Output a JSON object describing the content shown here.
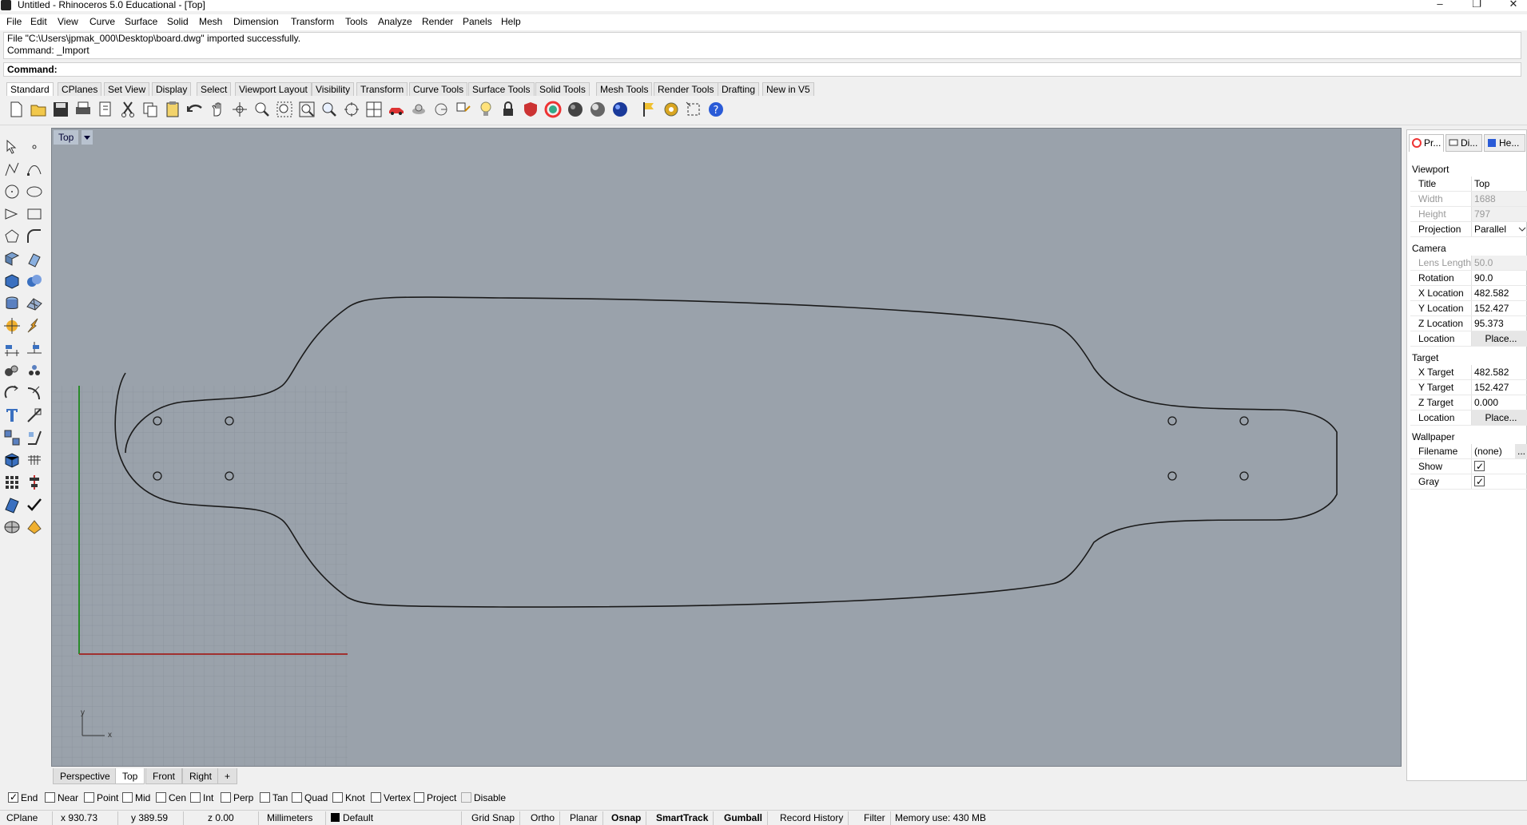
{
  "window": {
    "title": "Untitled - Rhinoceros 5.0 Educational - [Top]",
    "minimize": "–",
    "restore": "❐",
    "close": "✕"
  },
  "menu": [
    "File",
    "Edit",
    "View",
    "Curve",
    "Surface",
    "Solid",
    "Mesh",
    "Dimension",
    "Transform",
    "Tools",
    "Analyze",
    "Render",
    "Panels",
    "Help"
  ],
  "command_history": [
    "File \"C:\\Users\\jpmak_000\\Desktop\\board.dwg\" imported successfully.",
    "Command: _Import"
  ],
  "command_prompt": "Command:",
  "toolbar_tabs": [
    "Standard",
    "CPlanes",
    "Set View",
    "Display",
    "Select",
    "Viewport Layout",
    "Visibility",
    "Transform",
    "Curve Tools",
    "Surface Tools",
    "Solid Tools",
    "Mesh Tools",
    "Render Tools",
    "Drafting",
    "New in V5"
  ],
  "toolbar_icons": [
    "new-icon",
    "open-icon",
    "save-icon",
    "print-icon",
    "import-icon",
    "cut-icon",
    "copy-icon",
    "paste-icon",
    "undo-icon",
    "pan-icon",
    "rotate-view-icon",
    "zoom-window-icon",
    "zoom-extents-icon",
    "zoom-selected-icon",
    "zoom-icon",
    "zoom-all-icon",
    "four-viewports-icon",
    "car-icon",
    "gumball-icon",
    "circle-icon",
    "object-snap-icon",
    "light-icon",
    "lock-icon",
    "shield-icon",
    "color-wheel-icon",
    "shaded-sphere-icon",
    "rendered-sphere-icon",
    "blue-sphere-icon",
    "flag-icon",
    "options-gear-icon",
    "bounding-box-icon",
    "help-icon"
  ],
  "viewport": {
    "title": "Top",
    "axis_x": "x",
    "axis_y": "y"
  },
  "viewport_tabs": [
    "Perspective",
    "Top",
    "Front",
    "Right",
    "+"
  ],
  "osnap": [
    {
      "label": "End",
      "checked": true
    },
    {
      "label": "Near",
      "checked": false
    },
    {
      "label": "Point",
      "checked": false
    },
    {
      "label": "Mid",
      "checked": false
    },
    {
      "label": "Cen",
      "checked": false
    },
    {
      "label": "Int",
      "checked": false
    },
    {
      "label": "Perp",
      "checked": false
    },
    {
      "label": "Tan",
      "checked": false
    },
    {
      "label": "Quad",
      "checked": false
    },
    {
      "label": "Knot",
      "checked": false
    },
    {
      "label": "Vertex",
      "checked": false
    },
    {
      "label": "Project",
      "checked": false
    },
    {
      "label": "Disable",
      "checked": false
    }
  ],
  "status": {
    "cplane": "CPlane",
    "x": "x 930.73",
    "y": "y 389.59",
    "z": "z 0.00",
    "units": "Millimeters",
    "layer": "Default",
    "grid_snap": "Grid Snap",
    "ortho": "Ortho",
    "planar": "Planar",
    "osnap": "Osnap",
    "smarttrack": "SmartTrack",
    "gumball": "Gumball",
    "record_history": "Record History",
    "filter": "Filter",
    "memory": "Memory use: 430 MB"
  },
  "panel": {
    "tabs": [
      "Pr...",
      "Di...",
      "He..."
    ],
    "viewport_section": "Viewport",
    "title_label": "Title",
    "title_value": "Top",
    "width_label": "Width",
    "width_value": "1688",
    "height_label": "Height",
    "height_value": "797",
    "projection_label": "Projection",
    "projection_value": "Parallel",
    "camera_section": "Camera",
    "lens_label": "Lens Length",
    "lens_value": "50.0",
    "rotation_label": "Rotation",
    "rotation_value": "90.0",
    "xloc_label": "X Location",
    "xloc_value": "482.582",
    "yloc_label": "Y Location",
    "yloc_value": "152.427",
    "zloc_label": "Z Location",
    "zloc_value": "95.373",
    "loc_label": "Location",
    "place_label": "Place...",
    "target_section": "Target",
    "xt_label": "X Target",
    "xt_value": "482.582",
    "yt_label": "Y Target",
    "yt_value": "152.427",
    "zt_label": "Z Target",
    "zt_value": "0.000",
    "tloc_label": "Location",
    "tplace_label": "Place...",
    "wallpaper_section": "Wallpaper",
    "filename_label": "Filename",
    "filename_value": "(none)",
    "filename_btn": "...",
    "show_label": "Show",
    "show_checked": true,
    "gray_label": "Gray",
    "gray_checked": true
  },
  "colors": {
    "viewport_bg": "#9aa2ab",
    "grid_line": "#8a929b",
    "x_axis": "#a03030",
    "y_axis": "#2a8a2a",
    "curve": "#1a1a1a"
  }
}
